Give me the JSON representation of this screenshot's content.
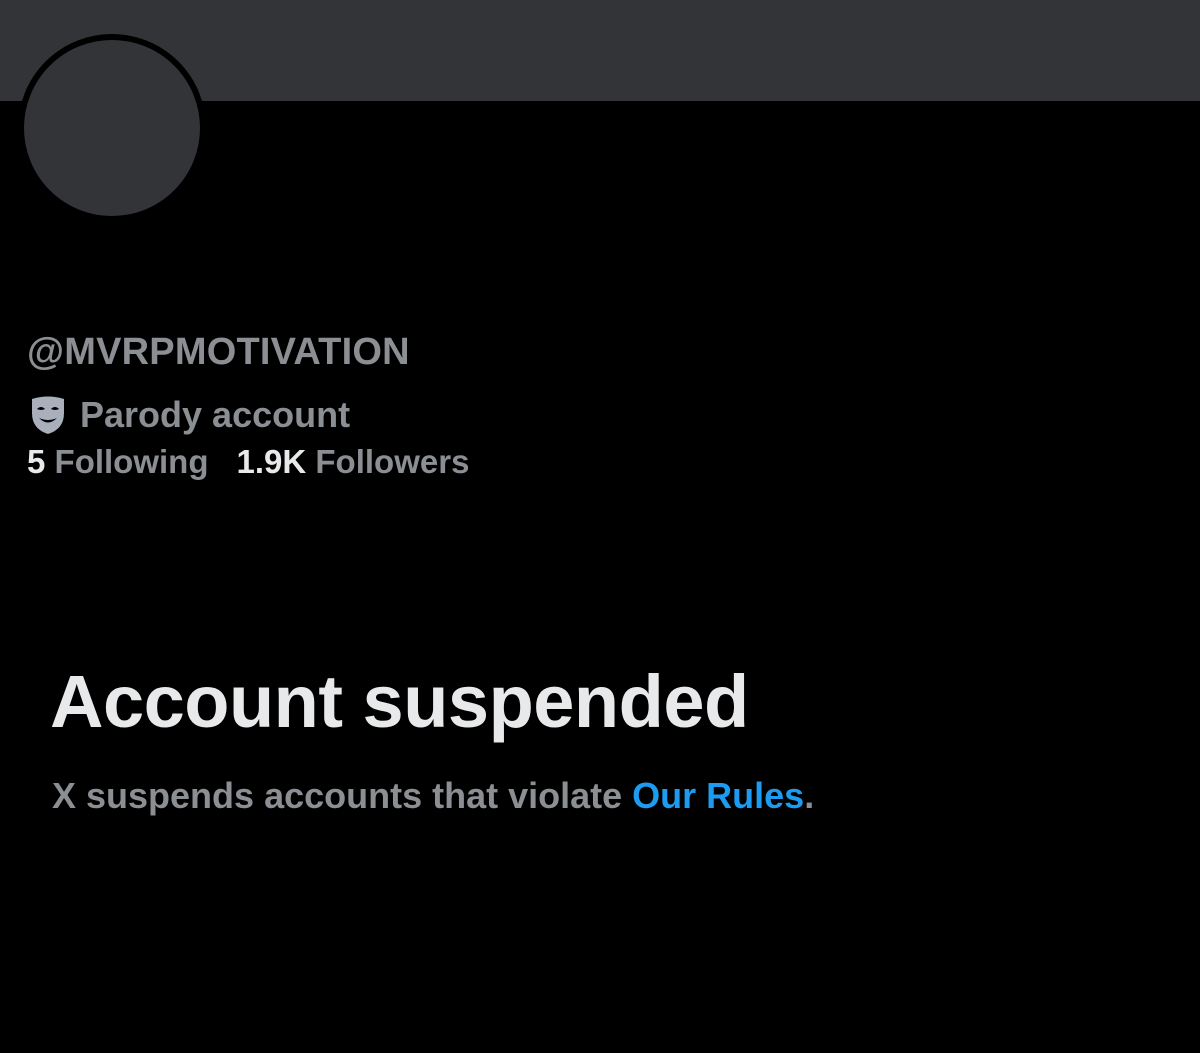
{
  "profile": {
    "handle": "@MVRPMOTIVATION",
    "label_icon": "parody-mask-icon",
    "label_text": "Parody account",
    "following_count": "5",
    "following_label": "Following",
    "followers_count": "1.9K",
    "followers_label": "Followers"
  },
  "suspension": {
    "title": "Account suspended",
    "message_prefix": "X suspends accounts that violate ",
    "rules_link": "Our Rules",
    "message_suffix": "."
  },
  "colors": {
    "background": "#000000",
    "banner": "#333438",
    "primary_text": "#e7e9ea",
    "secondary_text": "#8b8e93",
    "link": "#1d9bf0"
  }
}
